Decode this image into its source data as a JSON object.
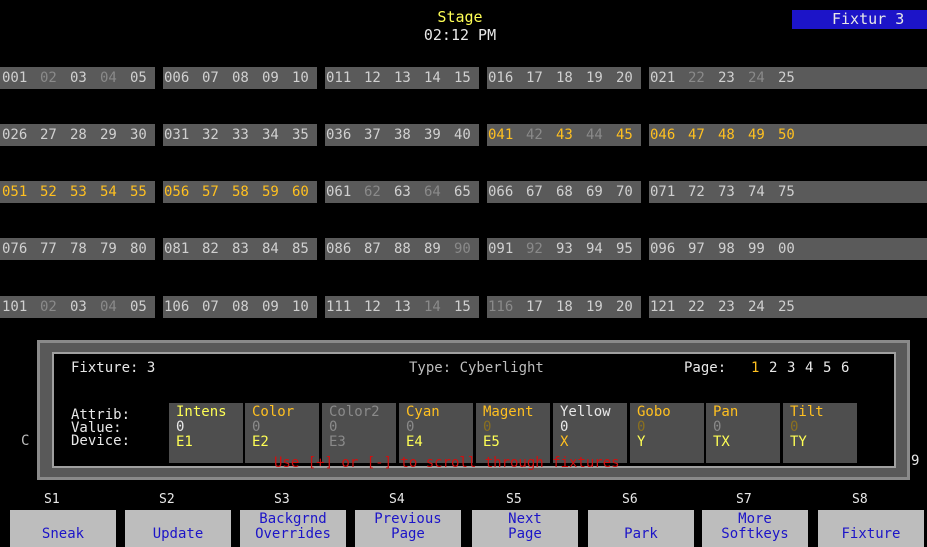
{
  "header": {
    "title": "Stage",
    "time": "02:12 PM",
    "mode_badge": "Fixtur 3"
  },
  "channel_rows": [
    [
      {
        "t": "001",
        "s": "n"
      },
      {
        "t": "02",
        "s": "d"
      },
      {
        "t": "03",
        "s": "n"
      },
      {
        "t": "04",
        "s": "d"
      },
      {
        "t": "05",
        "s": "n"
      },
      {
        "t": "006",
        "s": "n"
      },
      {
        "t": "07",
        "s": "n"
      },
      {
        "t": "08",
        "s": "n"
      },
      {
        "t": "09",
        "s": "n"
      },
      {
        "t": "10",
        "s": "n"
      },
      {
        "t": "011",
        "s": "n"
      },
      {
        "t": "12",
        "s": "n"
      },
      {
        "t": "13",
        "s": "n"
      },
      {
        "t": "14",
        "s": "n"
      },
      {
        "t": "15",
        "s": "n"
      },
      {
        "t": "016",
        "s": "n"
      },
      {
        "t": "17",
        "s": "n"
      },
      {
        "t": "18",
        "s": "n"
      },
      {
        "t": "19",
        "s": "n"
      },
      {
        "t": "20",
        "s": "n"
      },
      {
        "t": "021",
        "s": "n"
      },
      {
        "t": "22",
        "s": "d"
      },
      {
        "t": "23",
        "s": "n"
      },
      {
        "t": "24",
        "s": "d"
      },
      {
        "t": "25",
        "s": "n"
      }
    ],
    [
      {
        "t": "026",
        "s": "n"
      },
      {
        "t": "27",
        "s": "n"
      },
      {
        "t": "28",
        "s": "n"
      },
      {
        "t": "29",
        "s": "n"
      },
      {
        "t": "30",
        "s": "n"
      },
      {
        "t": "031",
        "s": "n"
      },
      {
        "t": "32",
        "s": "n"
      },
      {
        "t": "33",
        "s": "n"
      },
      {
        "t": "34",
        "s": "n"
      },
      {
        "t": "35",
        "s": "n"
      },
      {
        "t": "036",
        "s": "n"
      },
      {
        "t": "37",
        "s": "n"
      },
      {
        "t": "38",
        "s": "n"
      },
      {
        "t": "39",
        "s": "n"
      },
      {
        "t": "40",
        "s": "n"
      },
      {
        "t": "041",
        "s": "s"
      },
      {
        "t": "42",
        "s": "d"
      },
      {
        "t": "43",
        "s": "s"
      },
      {
        "t": "44",
        "s": "d"
      },
      {
        "t": "45",
        "s": "s"
      },
      {
        "t": "046",
        "s": "s"
      },
      {
        "t": "47",
        "s": "s"
      },
      {
        "t": "48",
        "s": "s"
      },
      {
        "t": "49",
        "s": "s"
      },
      {
        "t": "50",
        "s": "s"
      }
    ],
    [
      {
        "t": "051",
        "s": "s"
      },
      {
        "t": "52",
        "s": "s"
      },
      {
        "t": "53",
        "s": "s"
      },
      {
        "t": "54",
        "s": "s"
      },
      {
        "t": "55",
        "s": "s"
      },
      {
        "t": "056",
        "s": "s"
      },
      {
        "t": "57",
        "s": "s"
      },
      {
        "t": "58",
        "s": "s"
      },
      {
        "t": "59",
        "s": "s"
      },
      {
        "t": "60",
        "s": "s"
      },
      {
        "t": "061",
        "s": "n"
      },
      {
        "t": "62",
        "s": "d"
      },
      {
        "t": "63",
        "s": "n"
      },
      {
        "t": "64",
        "s": "d"
      },
      {
        "t": "65",
        "s": "n"
      },
      {
        "t": "066",
        "s": "n"
      },
      {
        "t": "67",
        "s": "n"
      },
      {
        "t": "68",
        "s": "n"
      },
      {
        "t": "69",
        "s": "n"
      },
      {
        "t": "70",
        "s": "n"
      },
      {
        "t": "071",
        "s": "n"
      },
      {
        "t": "72",
        "s": "n"
      },
      {
        "t": "73",
        "s": "n"
      },
      {
        "t": "74",
        "s": "n"
      },
      {
        "t": "75",
        "s": "n"
      }
    ],
    [
      {
        "t": "076",
        "s": "n"
      },
      {
        "t": "77",
        "s": "n"
      },
      {
        "t": "78",
        "s": "n"
      },
      {
        "t": "79",
        "s": "n"
      },
      {
        "t": "80",
        "s": "n"
      },
      {
        "t": "081",
        "s": "n"
      },
      {
        "t": "82",
        "s": "n"
      },
      {
        "t": "83",
        "s": "n"
      },
      {
        "t": "84",
        "s": "n"
      },
      {
        "t": "85",
        "s": "n"
      },
      {
        "t": "086",
        "s": "n"
      },
      {
        "t": "87",
        "s": "n"
      },
      {
        "t": "88",
        "s": "n"
      },
      {
        "t": "89",
        "s": "n"
      },
      {
        "t": "90",
        "s": "d"
      },
      {
        "t": "091",
        "s": "n"
      },
      {
        "t": "92",
        "s": "d"
      },
      {
        "t": "93",
        "s": "n"
      },
      {
        "t": "94",
        "s": "n"
      },
      {
        "t": "95",
        "s": "n"
      },
      {
        "t": "096",
        "s": "n"
      },
      {
        "t": "97",
        "s": "n"
      },
      {
        "t": "98",
        "s": "n"
      },
      {
        "t": "99",
        "s": "n"
      },
      {
        "t": "00",
        "s": "n"
      }
    ],
    [
      {
        "t": "101",
        "s": "n"
      },
      {
        "t": "02",
        "s": "d"
      },
      {
        "t": "03",
        "s": "n"
      },
      {
        "t": "04",
        "s": "d"
      },
      {
        "t": "05",
        "s": "n"
      },
      {
        "t": "106",
        "s": "n"
      },
      {
        "t": "07",
        "s": "n"
      },
      {
        "t": "08",
        "s": "n"
      },
      {
        "t": "09",
        "s": "n"
      },
      {
        "t": "10",
        "s": "n"
      },
      {
        "t": "111",
        "s": "n"
      },
      {
        "t": "12",
        "s": "n"
      },
      {
        "t": "13",
        "s": "n"
      },
      {
        "t": "14",
        "s": "d"
      },
      {
        "t": "15",
        "s": "n"
      },
      {
        "t": "116",
        "s": "d"
      },
      {
        "t": "17",
        "s": "n"
      },
      {
        "t": "18",
        "s": "n"
      },
      {
        "t": "19",
        "s": "n"
      },
      {
        "t": "20",
        "s": "n"
      },
      {
        "t": "121",
        "s": "n"
      },
      {
        "t": "22",
        "s": "n"
      },
      {
        "t": "23",
        "s": "n"
      },
      {
        "t": "24",
        "s": "n"
      },
      {
        "t": "25",
        "s": "n"
      }
    ]
  ],
  "fixture_dialog": {
    "fixture_label": "Fixture: 3",
    "type_label": "Type: Cyberlight",
    "page_label": "Page:",
    "pages": [
      "1",
      "2",
      "3",
      "4",
      "5",
      "6"
    ],
    "active_page": "1",
    "row_labels": [
      "Attrib:",
      "Value:",
      "Device:"
    ],
    "attributes": [
      {
        "name": "Intens",
        "value": "0",
        "device": "E1",
        "state": "active"
      },
      {
        "name": "Color",
        "value": "0",
        "device": "E2",
        "state": "normal"
      },
      {
        "name": "Color2",
        "value": "0",
        "device": "E3",
        "state": "disabled"
      },
      {
        "name": "Cyan",
        "value": "0",
        "device": "E4",
        "state": "normal"
      },
      {
        "name": "Magent",
        "value": "0",
        "device": "E5",
        "state": "dimmed"
      },
      {
        "name": "Yellow",
        "value": "0",
        "device": "X",
        "state": "white"
      },
      {
        "name": "Gobo",
        "value": "0",
        "device": "Y",
        "state": "dimmed"
      },
      {
        "name": "Pan",
        "value": "0",
        "device": "TX",
        "state": "normal"
      },
      {
        "name": "Tilt",
        "value": "0",
        "device": "TY",
        "state": "dimmed"
      }
    ],
    "hint": "Use [+] or [-] to scroll through fixtures"
  },
  "stray_left": "C",
  "stray_right": "9",
  "softkeys": [
    {
      "num": "S1",
      "line1": "",
      "line2": "Sneak"
    },
    {
      "num": "S2",
      "line1": "",
      "line2": "Update"
    },
    {
      "num": "S3",
      "line1": "Backgrnd",
      "line2": "Overrides"
    },
    {
      "num": "S4",
      "line1": "Previous",
      "line2": "Page"
    },
    {
      "num": "S5",
      "line1": "Next",
      "line2": "Page"
    },
    {
      "num": "S6",
      "line1": "",
      "line2": "Park"
    },
    {
      "num": "S7",
      "line1": "More",
      "line2": "Softkeys"
    },
    {
      "num": "S8",
      "line1": "",
      "line2": "Fixture"
    }
  ],
  "colors": {
    "selected_channel": "#ffc020",
    "dim_channel": "#8a8a8a",
    "softkey_text": "#1c14c8",
    "hint_text": "#d01010",
    "badge_bg": "#1c14c8"
  }
}
